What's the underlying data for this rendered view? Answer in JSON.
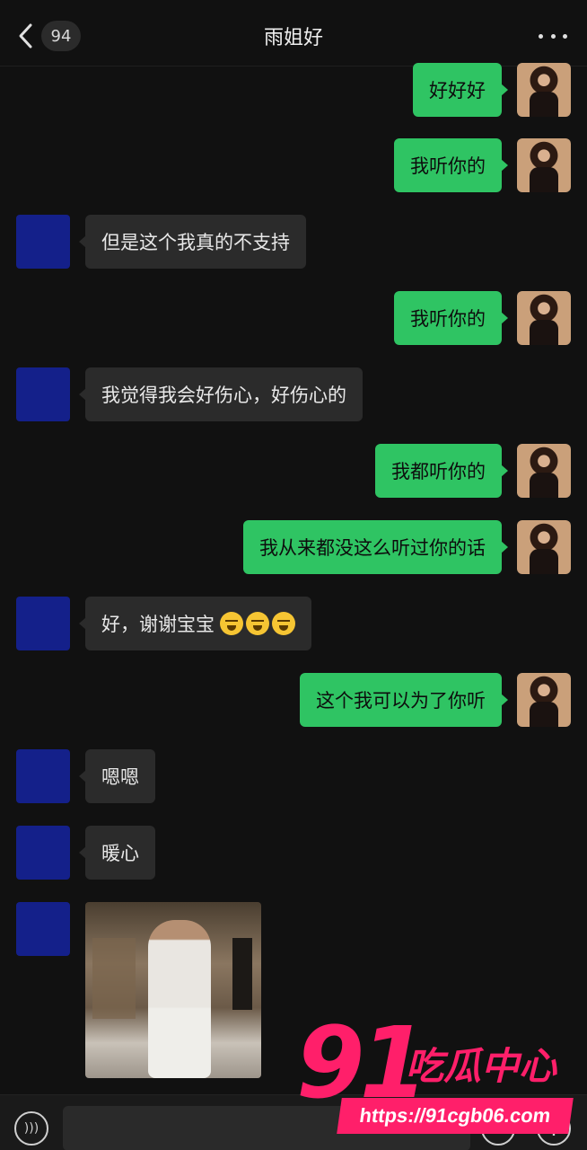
{
  "header": {
    "back_icon": "chevron-left-icon",
    "unread_count": "94",
    "title": "雨姐好",
    "more_icon": "more-icon"
  },
  "messages": [
    {
      "from": "me",
      "text": "好好好"
    },
    {
      "from": "me",
      "text": "我听你的"
    },
    {
      "from": "other",
      "text": "但是这个我真的不支持"
    },
    {
      "from": "me",
      "text": "我听你的"
    },
    {
      "from": "other",
      "text": "我觉得我会好伤心，好伤心的"
    },
    {
      "from": "me",
      "text": "我都听你的"
    },
    {
      "from": "me",
      "text": "我从来都没这么听过你的话"
    },
    {
      "from": "other",
      "text": "好，谢谢宝宝",
      "emoji_count": 3
    },
    {
      "from": "me",
      "text": "这个我可以为了你听"
    },
    {
      "from": "other",
      "text": "嗯嗯"
    },
    {
      "from": "other",
      "text": "暖心"
    },
    {
      "from": "other",
      "type": "image"
    }
  ],
  "bottom_bar": {
    "voice_icon": "voice-icon",
    "emoji_icon": "emoji-icon",
    "plus_icon": "plus-icon"
  },
  "watermark": {
    "brand_number": "91",
    "brand_text": "吃瓜中心",
    "url": "https://91cgb06.com"
  },
  "colors": {
    "background": "#111111",
    "my_bubble": "#2fc463",
    "other_bubble": "#2b2b2b",
    "other_avatar": "#14208a",
    "watermark": "#ff1f6a"
  }
}
